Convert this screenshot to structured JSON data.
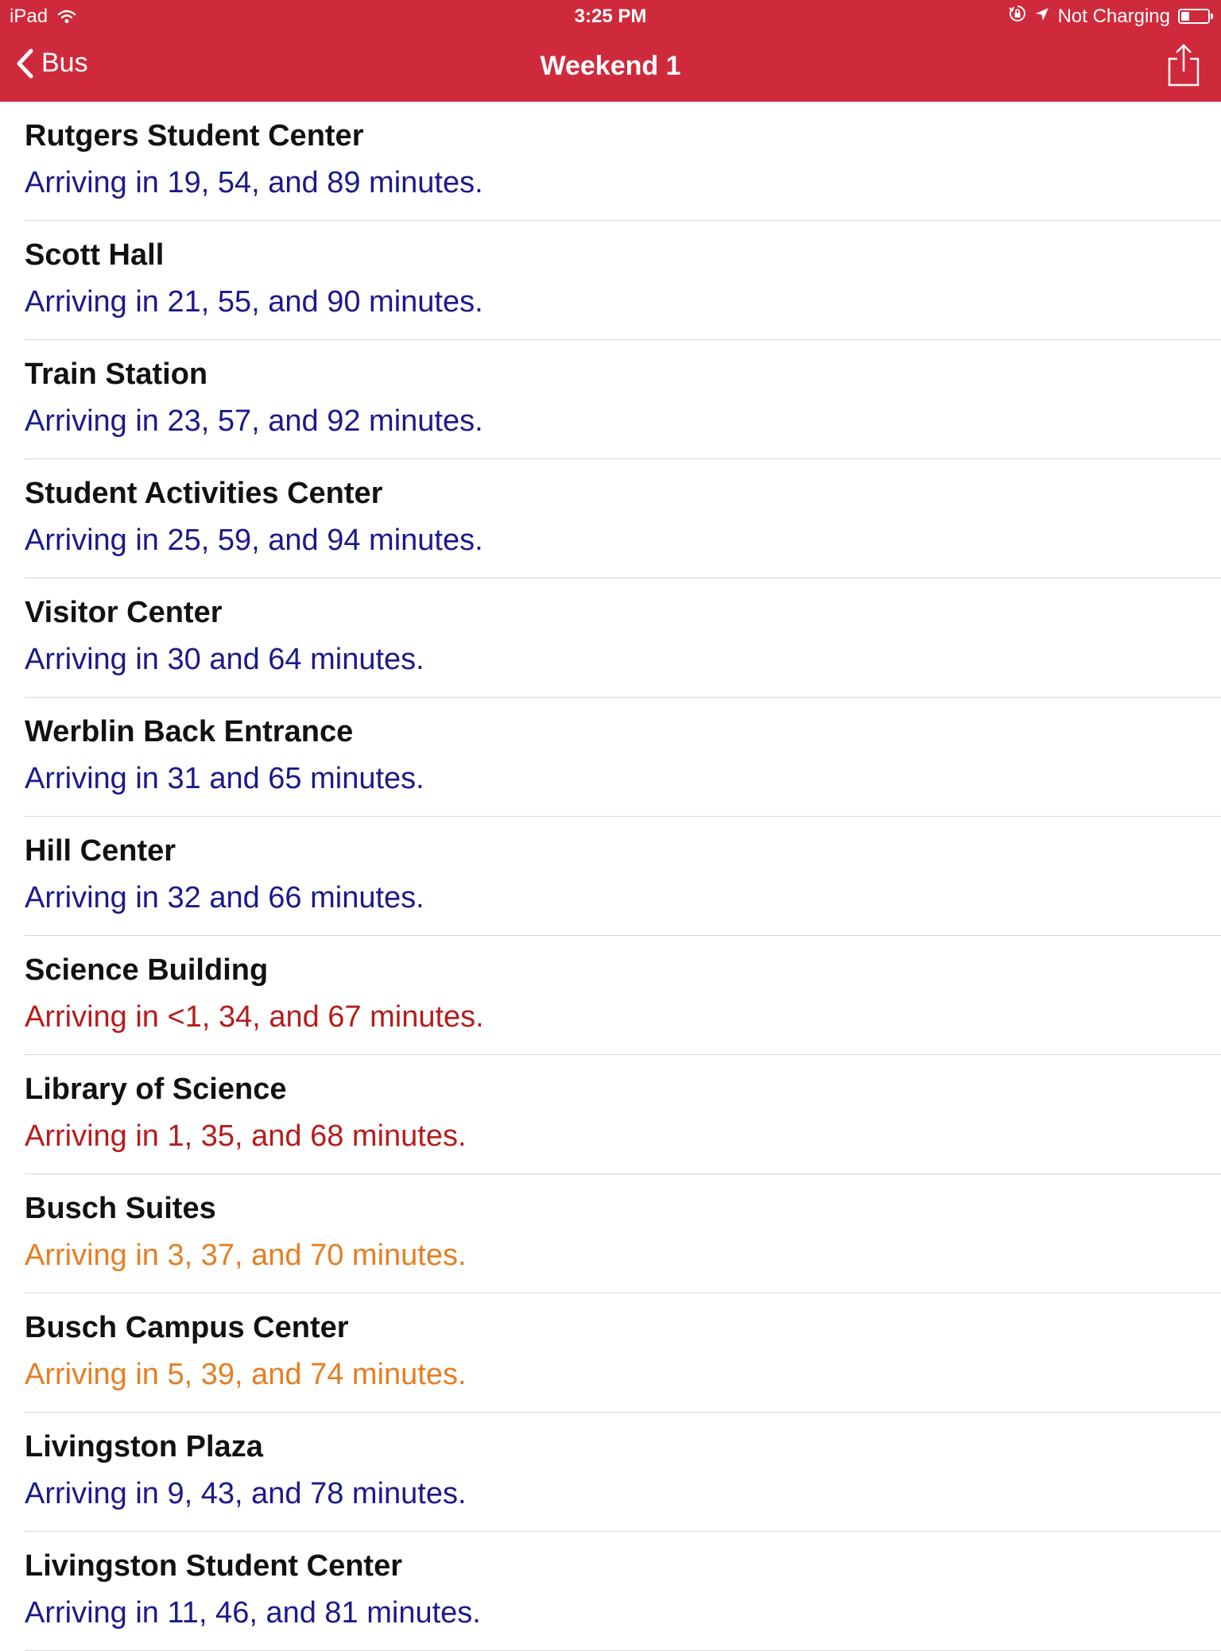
{
  "status_bar": {
    "device": "iPad",
    "time": "3:25 PM",
    "charging": "Not Charging",
    "battery_level": 0.3,
    "icons": [
      "wifi-icon",
      "orientation-lock-icon",
      "location-arrow-icon",
      "battery-icon"
    ]
  },
  "nav": {
    "back_label": "Bus",
    "title": "Weekend 1",
    "icons": [
      "chevron-left-icon",
      "share-icon"
    ]
  },
  "colors": {
    "header_bg": "#cf2a3b",
    "normal": "#1a1a8c",
    "imminent": "#b71c1c",
    "soon": "#e67e22",
    "divider": "#d6d6d6"
  },
  "stops": [
    {
      "name": "Rutgers Student Center",
      "arrival": "Arriving in 19, 54, and 89 minutes.",
      "status": "normal"
    },
    {
      "name": "Scott Hall",
      "arrival": "Arriving in 21, 55, and 90 minutes.",
      "status": "normal"
    },
    {
      "name": "Train Station",
      "arrival": "Arriving in 23, 57, and 92 minutes.",
      "status": "normal"
    },
    {
      "name": "Student Activities Center",
      "arrival": "Arriving in 25, 59, and 94 minutes.",
      "status": "normal"
    },
    {
      "name": "Visitor Center",
      "arrival": "Arriving in 30 and 64 minutes.",
      "status": "normal"
    },
    {
      "name": "Werblin Back Entrance",
      "arrival": "Arriving in 31 and 65 minutes.",
      "status": "normal"
    },
    {
      "name": "Hill Center",
      "arrival": "Arriving in 32 and 66 minutes.",
      "status": "normal"
    },
    {
      "name": "Science Building",
      "arrival": "Arriving in <1, 34, and 67 minutes.",
      "status": "imminent"
    },
    {
      "name": "Library of Science",
      "arrival": "Arriving in 1, 35, and 68 minutes.",
      "status": "imminent"
    },
    {
      "name": "Busch Suites",
      "arrival": "Arriving in 3, 37, and 70 minutes.",
      "status": "soon"
    },
    {
      "name": "Busch Campus Center",
      "arrival": "Arriving in 5, 39, and 74 minutes.",
      "status": "soon"
    },
    {
      "name": "Livingston Plaza",
      "arrival": "Arriving in 9, 43, and 78 minutes.",
      "status": "normal"
    },
    {
      "name": "Livingston Student Center",
      "arrival": "Arriving in 11, 46, and 81 minutes.",
      "status": "normal"
    }
  ]
}
